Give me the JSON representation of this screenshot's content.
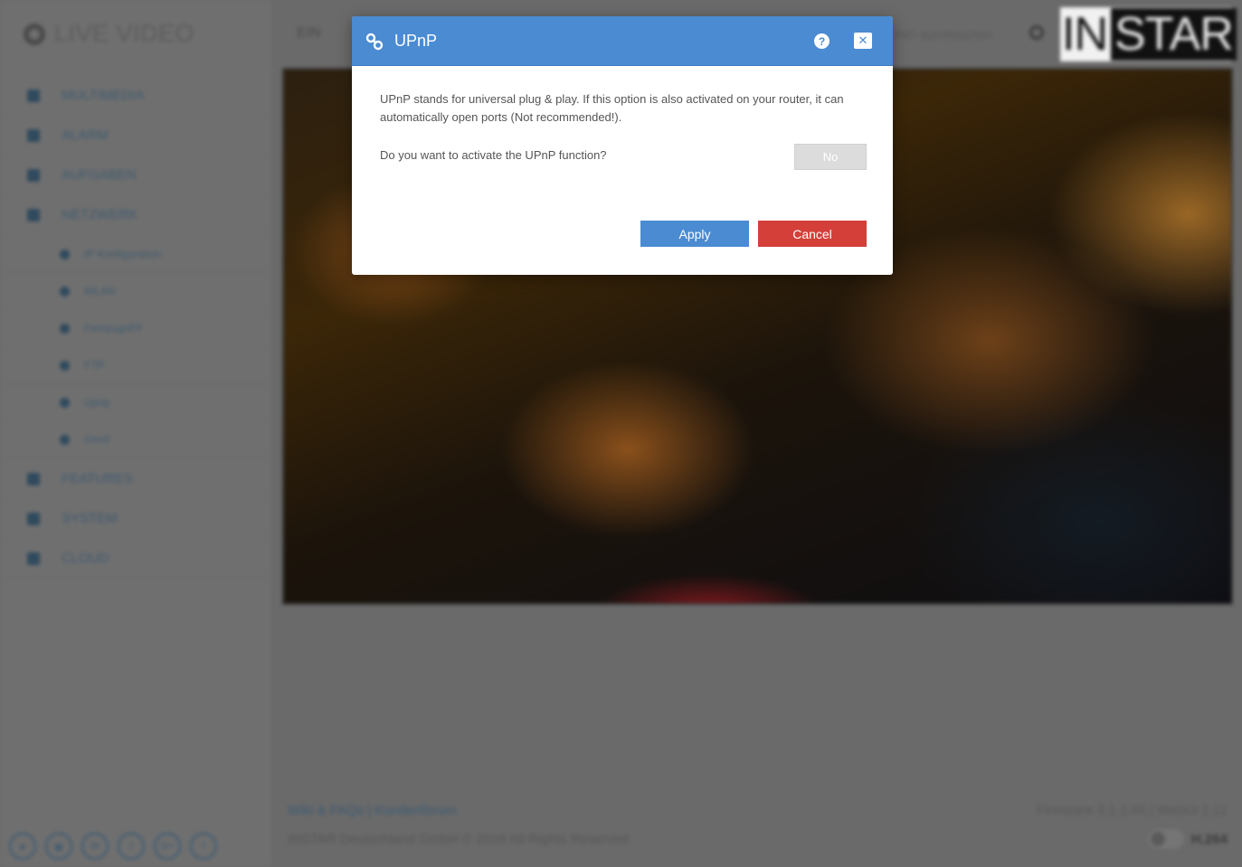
{
  "app": {
    "brand": "LIVE VIDEO",
    "logo_part1": "IN",
    "logo_part2": "STAR"
  },
  "sidebar": {
    "items": [
      {
        "label": "MULTIMEDIA",
        "icon": "image-icon"
      },
      {
        "label": "ALARM",
        "icon": "bell-icon"
      },
      {
        "label": "AUFGABEN",
        "icon": "calendar-icon"
      },
      {
        "label": "NETZWERK",
        "icon": "network-icon"
      }
    ],
    "subitems": [
      {
        "label": "IP Konfiguration",
        "icon": "globe-icon"
      },
      {
        "label": "WLAN",
        "icon": "wifi-icon"
      },
      {
        "label": "FernzugriFF",
        "icon": "remote-icon"
      },
      {
        "label": "FTP",
        "icon": "user-icon"
      },
      {
        "label": "Upnp",
        "icon": "link-icon"
      },
      {
        "label": "Onvif",
        "icon": "onvif-icon"
      }
    ],
    "bottom_items": [
      {
        "label": "FEATURES",
        "icon": "star-icon"
      },
      {
        "label": "SYSTEM",
        "icon": "gear-icon"
      },
      {
        "label": "CLOUD",
        "icon": "cloud-icon"
      }
    ],
    "social": [
      "▲",
      "▣",
      "W",
      "t",
      "G+",
      "f"
    ]
  },
  "topbar": {
    "setup_label": "EIN",
    "search_placeholder": "INO durchsuchen"
  },
  "footer": {
    "links": "Wiki & FAQs | Kundenforum",
    "copyright": "INSTAR Deutschland GmbH © 2016 All Rights Reserved",
    "firmware": "Firmware 3.1.2.45 | WebUI 1.11",
    "codec": "H.264"
  },
  "modal": {
    "title": "UPnP",
    "help_icon": "?",
    "close_icon": "✕",
    "description": "UPnP stands for universal plug & play. If this option is also activated on your router, it can automatically open ports (Not recommended!).",
    "question": "Do you want to activate the UPnP function?",
    "toggle_value": "No",
    "apply_label": "Apply",
    "cancel_label": "Cancel",
    "colors": {
      "header": "#4a8bd2",
      "apply": "#4a8bd2",
      "cancel": "#d43f3a"
    }
  }
}
